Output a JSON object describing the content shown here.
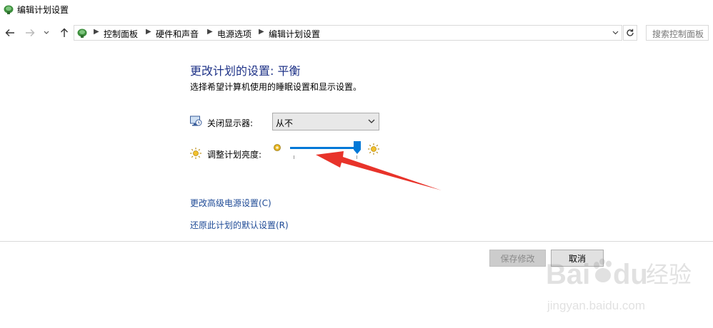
{
  "window": {
    "title": "编辑计划设置"
  },
  "nav": {
    "back_icon": "arrow-left-icon",
    "forward_icon": "arrow-right-icon",
    "recent_icon": "chevron-down-icon",
    "up_icon": "arrow-up-icon"
  },
  "address": {
    "breadcrumbs": [
      "控制面板",
      "硬件和声音",
      "电源选项",
      "编辑计划设置"
    ]
  },
  "search": {
    "placeholder": "搜索控制面板"
  },
  "main": {
    "heading": "更改计划的设置: 平衡",
    "subheading": "选择希望计算机使用的睡眠设置和显示设置。",
    "display_off_label": "关闭显示器:",
    "display_off_value": "从不",
    "brightness_label": "调整计划亮度:",
    "brightness_level": 1.0,
    "advanced_link": "更改高级电源设置(C)",
    "restore_link": "还原此计划的默认设置(R)"
  },
  "footer": {
    "save_label": "保存修改",
    "cancel_label": "取消"
  },
  "annotation": {
    "arrow_color": "#e8332a"
  },
  "watermark": {
    "brand": "Baidu 经验",
    "url": "jingyan.baidu.com"
  },
  "colors": {
    "heading": "#1e3287",
    "link": "#1e4a96",
    "accent": "#0078d7"
  }
}
